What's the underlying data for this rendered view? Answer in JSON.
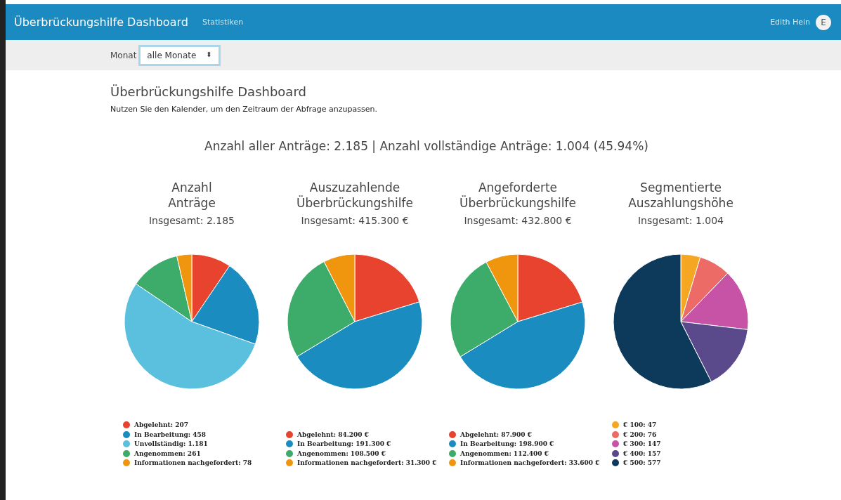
{
  "navbar": {
    "brand": "Überbrückungshilfe Dashboard",
    "links": [
      "Statistiken"
    ],
    "user": "Edith Hein",
    "avatar": "E"
  },
  "filter": {
    "label": "Monat",
    "value": "alle Monate",
    "caret": "⬍"
  },
  "heading": "Überbrückungshilfe Dashboard",
  "intro": "Nutzen Sie den Kalender, um den Zeitraum der Abfrage anzupassen.",
  "summary": "Anzahl aller Anträge: 2.185 | Anzahl vollständige Anträge: 1.004 (45.94%)",
  "charts": [
    {
      "title_lines": [
        "Anzahl",
        "Anträge"
      ],
      "total": "Insgesamt: 2.185",
      "legend": [
        {
          "label": "Abgelehnt: 207",
          "color": "#e8432e"
        },
        {
          "label": "In Bearbeitung: 458",
          "color": "#1a8cc0"
        },
        {
          "label": "Unvollständig: 1.181",
          "color": "#5bc0de"
        },
        {
          "label": "Angenommen: 261",
          "color": "#3dab6a"
        },
        {
          "label": "Informationen nachgefordert: 78",
          "color": "#f0960e"
        }
      ],
      "chart_data": {
        "type": "pie",
        "values": [
          9.47,
          20.96,
          54.05,
          11.95,
          3.57
        ]
      }
    },
    {
      "title_lines": [
        "Auszuzahlende",
        "Überbrückungshilfe"
      ],
      "total": "Insgesamt: 415.300 €",
      "legend": [
        {
          "label": "Abgelehnt: 84.200 €",
          "color": "#e8432e"
        },
        {
          "label": "In Bearbeitung: 191.300 €",
          "color": "#1a8cc0"
        },
        {
          "label": "Angenommen: 108.500 €",
          "color": "#3dab6a"
        },
        {
          "label": "Informationen nachgefordert: 31.300 €",
          "color": "#f0960e"
        }
      ],
      "chart_data": {
        "type": "pie",
        "values": [
          20.27,
          46.06,
          26.13,
          7.54
        ]
      }
    },
    {
      "title_lines": [
        "Angeforderte",
        "Überbrückungshilfe"
      ],
      "total": "Insgesamt: 432.800 €",
      "legend": [
        {
          "label": "Abgelehnt: 87.900 €",
          "color": "#e8432e"
        },
        {
          "label": "In Bearbeitung: 198.900 €",
          "color": "#1a8cc0"
        },
        {
          "label": "Angenommen: 112.400 €",
          "color": "#3dab6a"
        },
        {
          "label": "Informationen nachgefordert: 33.600 €",
          "color": "#f0960e"
        }
      ],
      "chart_data": {
        "type": "pie",
        "values": [
          20.31,
          45.96,
          25.97,
          7.76
        ]
      }
    },
    {
      "title_lines": [
        "Segmentierte",
        "Auszahlungshöhe"
      ],
      "total": "Insgesamt: 1.004",
      "legend": [
        {
          "label": "€ 100: 47",
          "color": "#f5a623"
        },
        {
          "label": "€ 200: 76",
          "color": "#ec6b66"
        },
        {
          "label": "€ 300: 147",
          "color": "#c653a6"
        },
        {
          "label": "€ 400: 157",
          "color": "#5b4a8b"
        },
        {
          "label": "€ 500: 577",
          "color": "#0d3a5a"
        }
      ],
      "chart_data": {
        "type": "pie",
        "values": [
          4.68,
          7.57,
          14.64,
          15.64,
          57.47
        ]
      }
    }
  ]
}
